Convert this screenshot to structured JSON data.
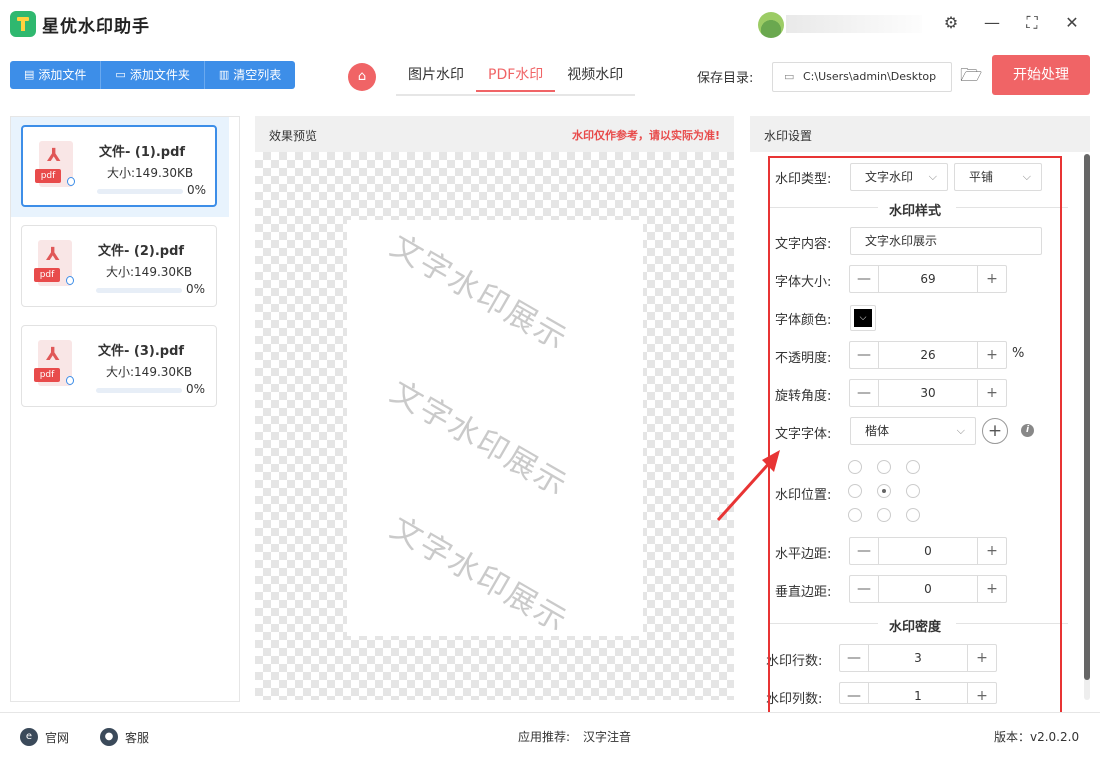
{
  "app": {
    "title": "星优水印助手"
  },
  "window": {
    "settings_glyph": "⚙",
    "minimize_glyph": "—",
    "maximize_glyph": "⛶",
    "close_glyph": "✕"
  },
  "toolbar": {
    "add_file": "添加文件",
    "add_folder": "添加文件夹",
    "clear_list": "清空列表",
    "tabs": [
      "图片水印",
      "PDF水印",
      "视频水印"
    ],
    "active_tab": "PDF水印",
    "save_label": "保存目录:",
    "save_path": "C:\\Users\\admin\\Desktop",
    "start": "开始处理"
  },
  "files": [
    {
      "name": "文件- (1).pdf",
      "size": "大小:149.30KB",
      "progress": "0%",
      "progress_value": 0
    },
    {
      "name": "文件- (2).pdf",
      "size": "大小:149.30KB",
      "progress": "0%",
      "progress_value": 0
    },
    {
      "name": "文件- (3).pdf",
      "size": "大小:149.30KB",
      "progress": "0%",
      "progress_value": 0
    }
  ],
  "pdf_tag": "pdf",
  "preview": {
    "title": "效果预览",
    "note": "水印仅作参考，请以实际为准!",
    "watermark_text": "文字水印展示"
  },
  "settings": {
    "title": "水印设置",
    "type_label": "水印类型:",
    "type_value": "文字水印",
    "tile_value": "平铺",
    "style_title": "水印样式",
    "text_label": "文字内容:",
    "text_value": "文字水印展示",
    "size_label": "字体大小:",
    "size_value": "69",
    "color_label": "字体颜色:",
    "color_value": "#000000",
    "opacity_label": "不透明度:",
    "opacity_value": "26",
    "opacity_unit": "%",
    "rotate_label": "旋转角度:",
    "rotate_value": "30",
    "font_label": "文字字体:",
    "font_value": "楷体",
    "position_label": "水印位置:",
    "h_margin_label": "水平边距:",
    "h_margin_value": "0",
    "v_margin_label": "垂直边距:",
    "v_margin_value": "0",
    "density_title": "水印密度",
    "rows_label": "水印行数:",
    "rows_value": "3",
    "cols_label": "水印列数:",
    "cols_value": "1",
    "minus": "—",
    "plus": "+"
  },
  "footer": {
    "website": "官网",
    "service": "客服",
    "recommend_label": "应用推荐:",
    "recommend_app": "汉字注音",
    "version": "版本：v2.0.2.0"
  },
  "colors": {
    "accent_red": "#f06466",
    "accent_blue": "#3d8ee8",
    "highlight": "#e83434"
  }
}
